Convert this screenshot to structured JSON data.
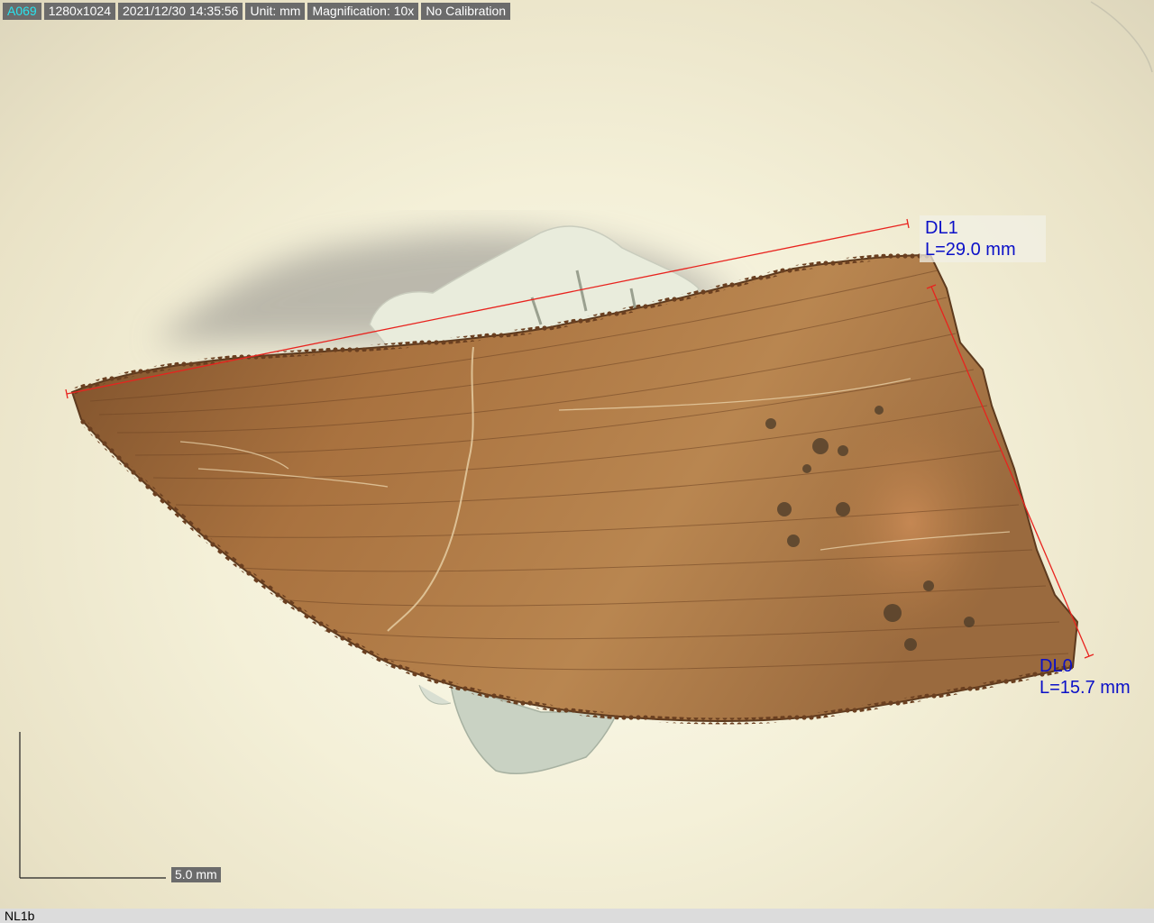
{
  "status_bar": {
    "image_id": "A069",
    "resolution": "1280x1024",
    "datetime": "2021/12/30 14:35:56",
    "unit": "Unit: mm",
    "magnification": "Magnification:  10x",
    "calibration": "No Calibration"
  },
  "measurements": [
    {
      "name": "DL1",
      "length": "L=29.0 mm"
    },
    {
      "name": "DL0",
      "length": "L=15.7 mm"
    }
  ],
  "scale_bar": {
    "label": "5.0 mm"
  },
  "sample": {
    "name": "NL1b"
  },
  "colors": {
    "status_bg": "#6b6b6b",
    "status_id_text": "#29e3ee",
    "measure_line": "#e8231e",
    "measure_text": "#0b10c8",
    "tooth_base": "#a8733f"
  }
}
